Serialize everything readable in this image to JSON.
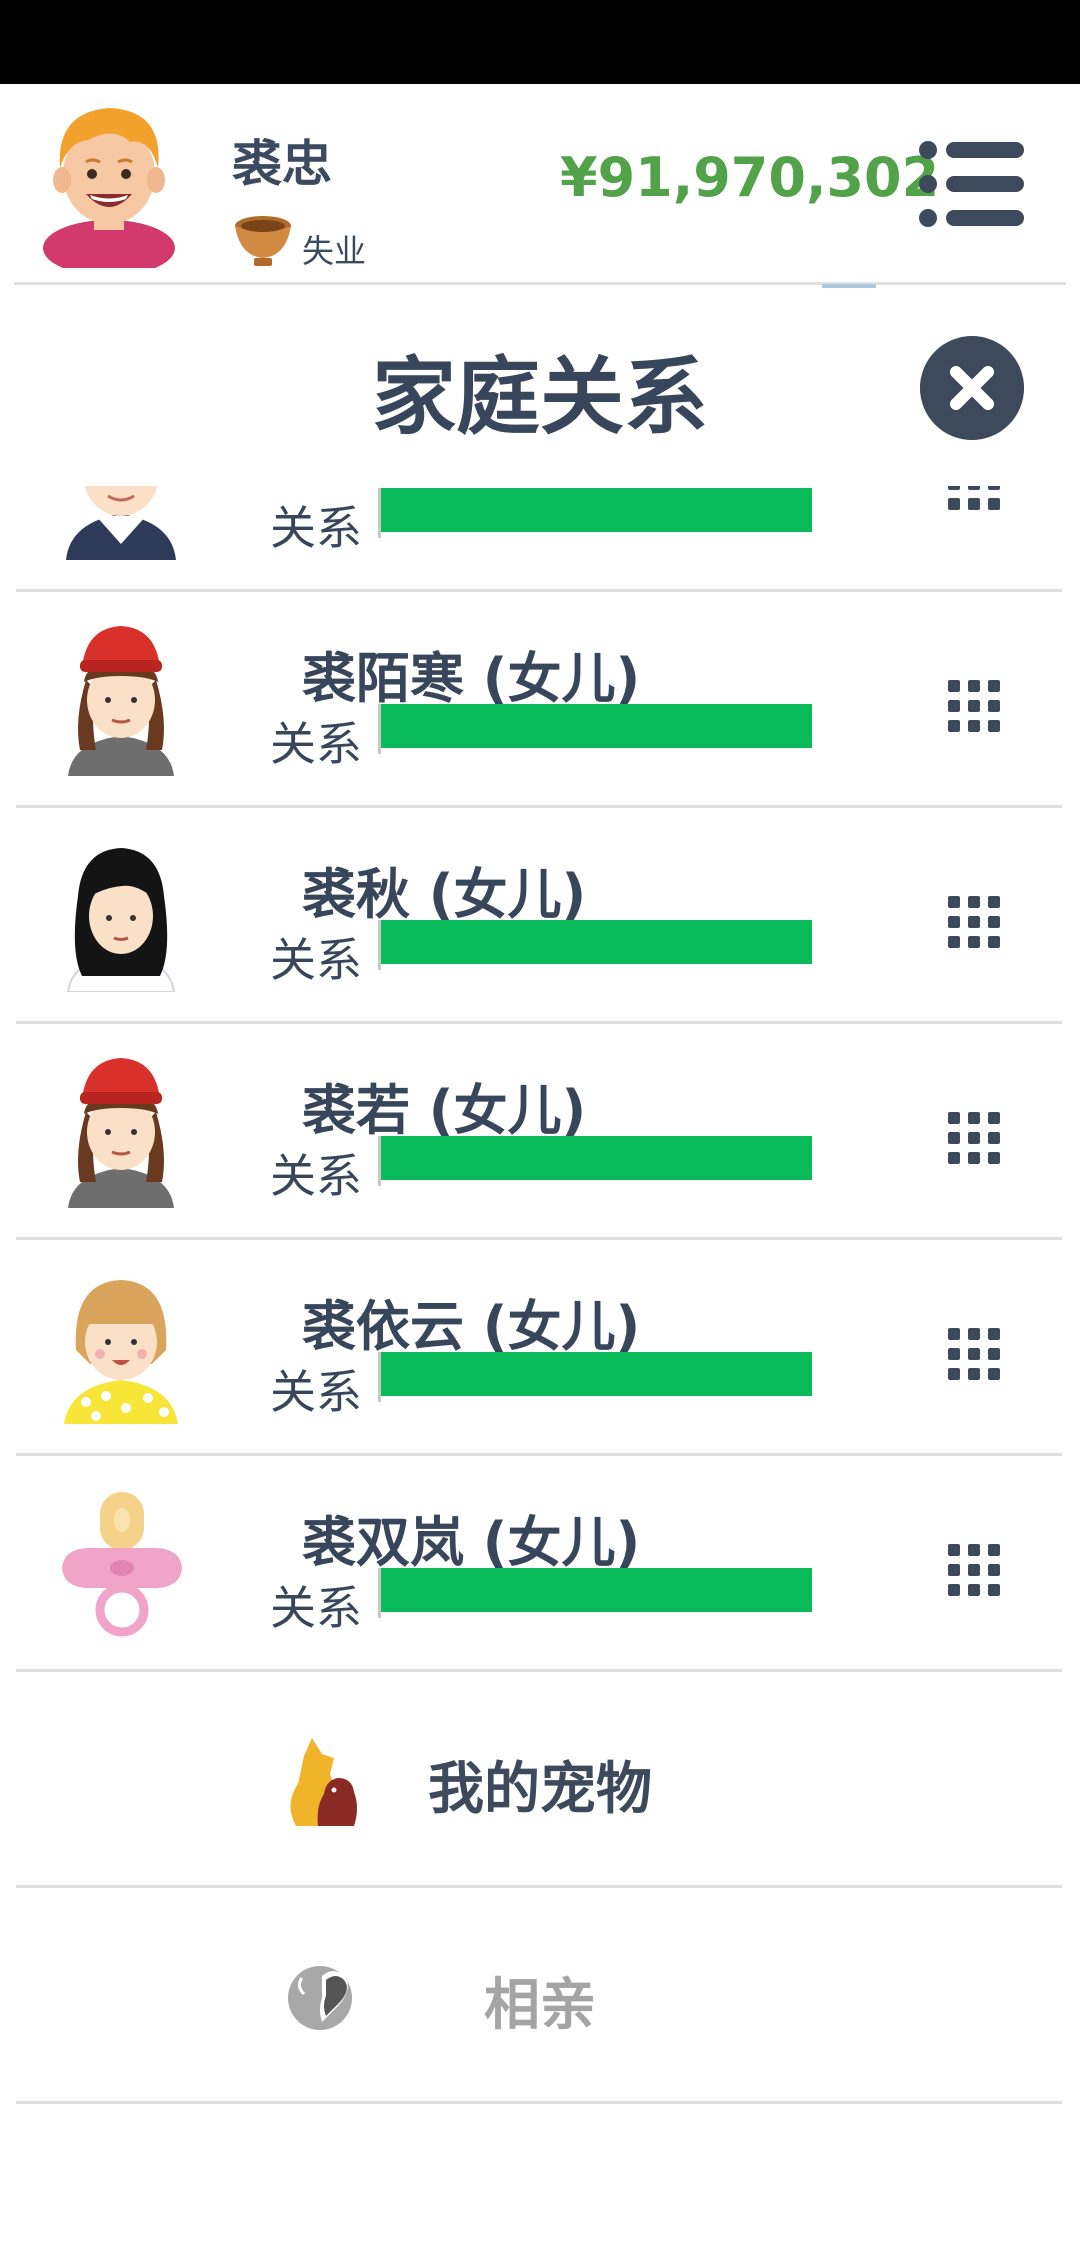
{
  "header": {
    "name": "裘忠",
    "job": "失业",
    "money": "¥91,970,302"
  },
  "dialog": {
    "title": "家庭关系"
  },
  "relation_label": "关系",
  "members": [
    {
      "name": "",
      "relation_level": 1.0,
      "avatar": "schoolgirl-avatar"
    },
    {
      "name": "裘陌寒 (女儿)",
      "relation_level": 1.0,
      "avatar": "red-hat-girl-avatar"
    },
    {
      "name": "裘秋 (女儿)",
      "relation_level": 1.0,
      "avatar": "black-hair-girl-avatar"
    },
    {
      "name": "裘若 (女儿)",
      "relation_level": 1.0,
      "avatar": "red-hat-girl-avatar"
    },
    {
      "name": "裘依云 (女儿)",
      "relation_level": 1.0,
      "avatar": "blonde-girl-avatar"
    },
    {
      "name": "裘双岚 (女儿)",
      "relation_level": 1.0,
      "avatar": "pacifier-baby-avatar"
    }
  ],
  "actions": {
    "pets": "我的宠物",
    "dating": "相亲"
  },
  "colors": {
    "bar": "#09bb5a",
    "money": "#52a24a",
    "text": "#37465a"
  }
}
